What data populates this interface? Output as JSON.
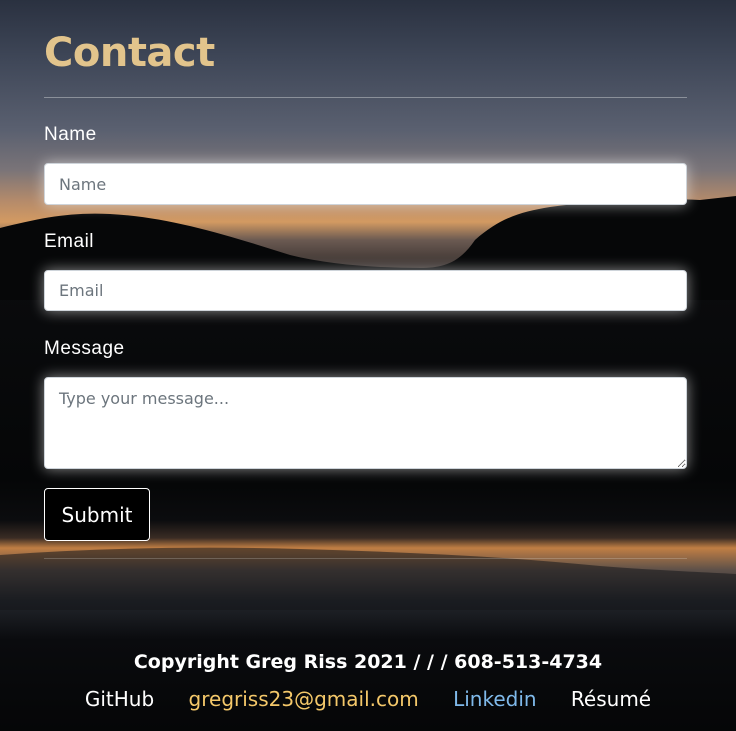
{
  "contact": {
    "title": "Contact"
  },
  "form": {
    "name_label": "Name",
    "name_placeholder": "Name",
    "email_label": "Email",
    "email_placeholder": "Email",
    "message_label": "Message",
    "message_placeholder": "Type your message...",
    "submit_label": "Submit"
  },
  "footer": {
    "copyright": "Copyright Greg Riss 2021 / / / 608-513-4734",
    "links": [
      {
        "label": "GitHub",
        "color": "#ffffff"
      },
      {
        "label": "gregriss23@gmail.com",
        "color": "#f4c86a"
      },
      {
        "label": "Linkedin",
        "color": "#7fb9ea"
      },
      {
        "label": "Résumé",
        "color": "#ffffff"
      }
    ]
  },
  "colors": {
    "title": "#e2c48c",
    "background": "#050607"
  }
}
